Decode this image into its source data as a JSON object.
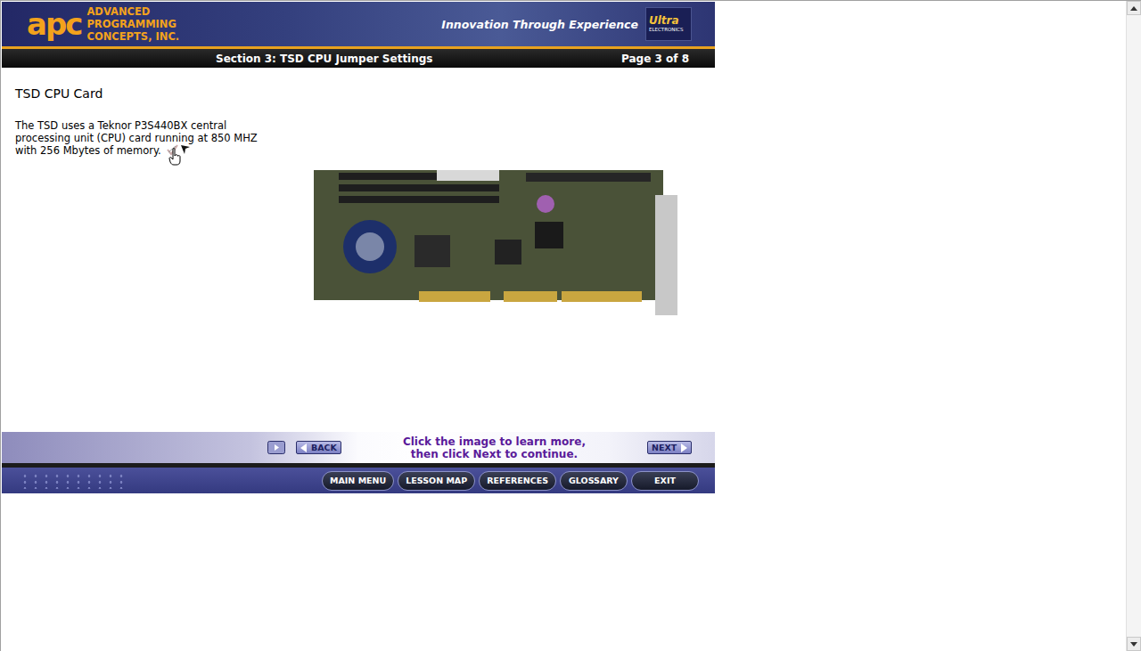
{
  "header": {
    "logo": "apc",
    "company_lines": [
      "ADVANCED",
      "PROGRAMMING",
      "CONCEPTS, INC."
    ],
    "tagline": "Innovation Through Experience",
    "partner": {
      "name": "Ultra",
      "sub": "ELECTRONICS"
    }
  },
  "section_bar": {
    "title": "Section 3: TSD CPU Jumper Settings",
    "page": "Page 3 of 8"
  },
  "content": {
    "heading": "TSD CPU Card",
    "paragraph_lines": [
      "The TSD uses a Teknor P3S440BX central",
      "processing unit (CPU) card running at 850 MHZ",
      "with 256 Mbytes of memory."
    ]
  },
  "nav": {
    "back": "BACK",
    "next": "NEXT",
    "instruction_lines": [
      "Click the image to learn more,",
      "then click Next to continue."
    ]
  },
  "menu": [
    "MAIN MENU",
    "LESSON MAP",
    "REFERENCES",
    "GLOSSARY",
    "EXIT"
  ]
}
